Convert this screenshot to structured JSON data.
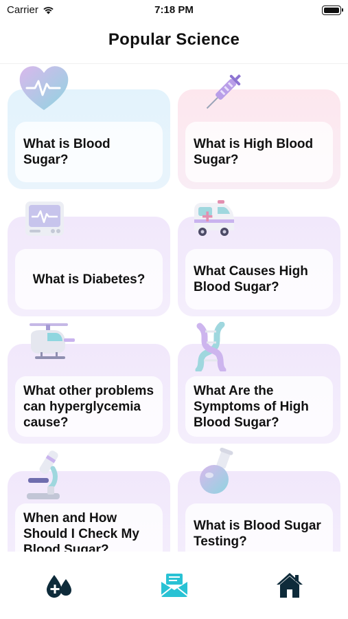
{
  "status_bar": {
    "carrier": "Carrier",
    "time": "7:18 PM",
    "icons": [
      "wifi-icon",
      "battery-icon"
    ]
  },
  "header": {
    "title": "Popular Science"
  },
  "cards": [
    {
      "title": "What is Blood Sugar?",
      "icon": "heart-monitor-icon",
      "theme": "blue"
    },
    {
      "title": "What is High Blood Sugar?",
      "icon": "syringe-icon",
      "theme": "pink"
    },
    {
      "title": "What is Diabetes?",
      "icon": "monitor-icon",
      "theme": "purple"
    },
    {
      "title": "What Causes High Blood Sugar?",
      "icon": "ambulance-icon",
      "theme": "purple"
    },
    {
      "title": "What other problems can hyperglycemia cause?",
      "icon": "helicopter-icon",
      "theme": "purple"
    },
    {
      "title": "What Are the Symptoms of High Blood Sugar?",
      "icon": "dna-icon",
      "theme": "purple"
    },
    {
      "title": "When and How Should I Check My Blood Sugar?",
      "icon": "microscope-icon",
      "theme": "purple"
    },
    {
      "title": "What is Blood Sugar Testing?",
      "icon": "flask-icon",
      "theme": "purple"
    }
  ],
  "tab_bar": {
    "tabs": [
      {
        "icon": "blood-drops-icon",
        "active": false
      },
      {
        "icon": "mail-icon",
        "active": true
      },
      {
        "icon": "home-icon",
        "active": false
      }
    ],
    "colors": {
      "active": "#29c2d4",
      "inactive": "#0e2b3a"
    }
  }
}
